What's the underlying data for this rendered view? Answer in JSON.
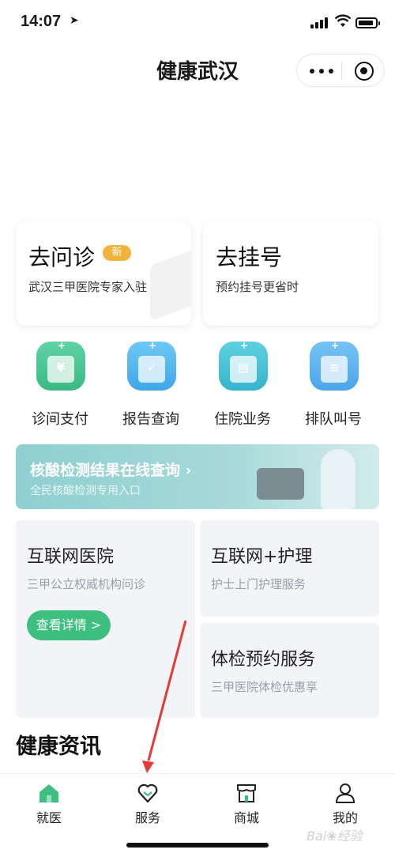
{
  "status_bar": {
    "time": "14:07"
  },
  "nav": {
    "title": "健康武汉"
  },
  "cards": [
    {
      "title": "去问诊",
      "badge": "新",
      "subtitle": "武汉三甲医院专家入驻"
    },
    {
      "title": "去挂号",
      "subtitle": "预约挂号更省时"
    }
  ],
  "services": [
    {
      "label": "诊间支付",
      "icon": "payment-icon",
      "glyph": "¥"
    },
    {
      "label": "报告查询",
      "icon": "report-icon",
      "glyph": "✓"
    },
    {
      "label": "住院业务",
      "icon": "hospital-building-icon",
      "glyph": "▤"
    },
    {
      "label": "排队叫号",
      "icon": "queue-ticket-icon",
      "glyph": "≡"
    }
  ],
  "banner": {
    "title": "核酸检测结果在线查询 ›",
    "subtitle": "全民核酸检测专用入口"
  },
  "panels": {
    "internet_hospital": {
      "title": "互联网医院",
      "subtitle": "三甲公立权威机构问诊",
      "button": "查看详情 >"
    },
    "internet_nursing": {
      "title": "互联网+护理",
      "subtitle": "护士上门护理服务"
    },
    "checkup": {
      "title": "体检预约服务",
      "subtitle": "三甲医院体检优惠享"
    }
  },
  "news": {
    "title": "健康资讯"
  },
  "tab_bar": {
    "tabs": [
      {
        "label": "就医",
        "icon": "home-icon",
        "active": true
      },
      {
        "label": "服务",
        "icon": "heart-service-icon",
        "active": false
      },
      {
        "label": "商城",
        "icon": "store-icon",
        "active": false
      },
      {
        "label": "我的",
        "icon": "profile-icon",
        "active": false
      }
    ]
  },
  "watermark": "Bai❀经验",
  "colors": {
    "accent_green": "#3dbf7f",
    "badge_orange": "#f2b33d",
    "arrow_red": "#e53935"
  }
}
